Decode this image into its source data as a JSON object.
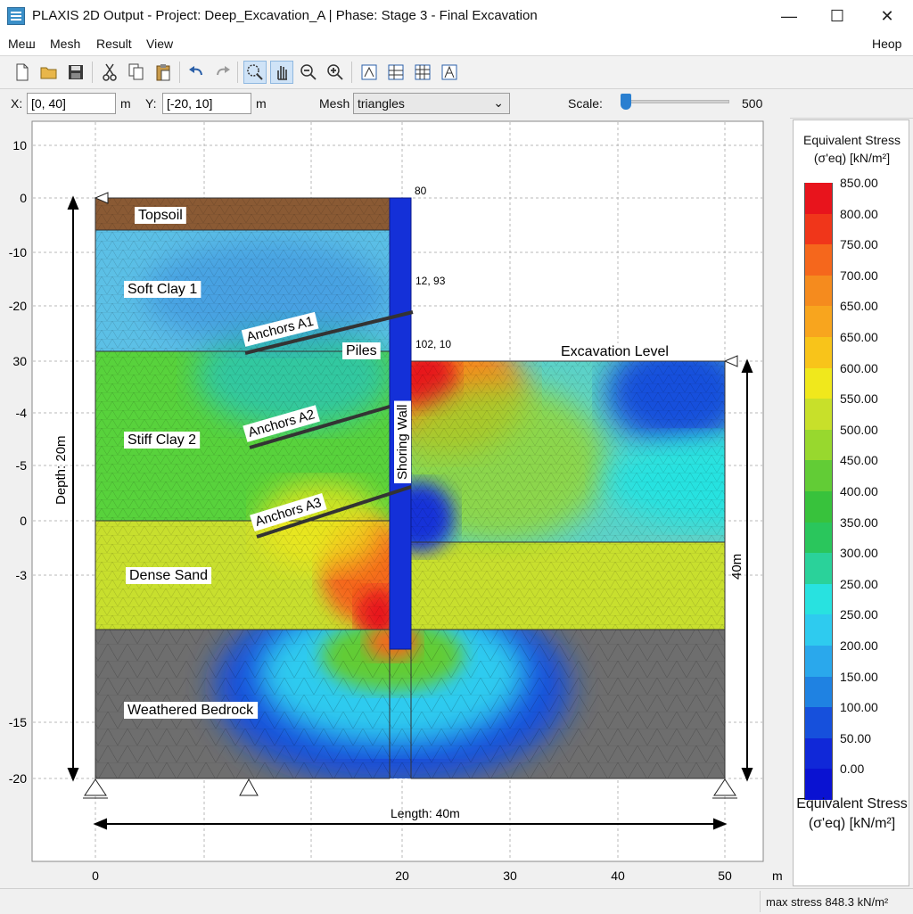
{
  "window": {
    "title": "PLAXIS 2D Output - Project: Deep_Excavation_A | Phase: Stage 3 - Final Excavation",
    "minimize": "—",
    "maximize": "☐",
    "close": "✕"
  },
  "menu": {
    "items": [
      "Meш",
      "Mesh",
      "Result",
      "View"
    ],
    "help": "Неор"
  },
  "toolbar": {
    "icons": [
      "new-file-icon",
      "open-folder-icon",
      "save-icon",
      "cut-icon",
      "copy-icon",
      "paste-icon",
      "undo-icon",
      "redo-icon",
      "zoom-window-icon",
      "pan-hand-icon",
      "zoom-out-icon",
      "zoom-in-icon",
      "view-front-icon",
      "view-mesh-icon",
      "view-grid-icon",
      "view-structure-icon"
    ]
  },
  "coords": {
    "x_label": "X:",
    "x_value": "[0, 40]",
    "x_unit": "m",
    "y_label": "Y:",
    "y_value": "[-20, 10]",
    "y_unit": "m",
    "mesh_label": "Mesh",
    "mesh_value": "triangles",
    "scale_label": "Scale:",
    "scale_value": "500",
    "scale_fraction": 0.0
  },
  "plot": {
    "y_ticks": [
      "10",
      "0",
      "-10",
      "-20",
      "30",
      "-4",
      "-5",
      "0",
      "-3",
      "-15",
      "-20"
    ],
    "x_ticks": [
      "0",
      "20",
      "30",
      "40",
      "50"
    ],
    "x_unit": "m",
    "layers": [
      "Topsoil",
      "Soft Clay 1",
      "Stiff Clay 2",
      "Dense Sand",
      "Weathered Bedrock"
    ],
    "anchors": [
      "Anchors A1",
      "Anchors A2",
      "Anchors A3"
    ],
    "piles_label": "Piles",
    "wall_label": "Shoring Wall",
    "excavation_label": "Excavation Level",
    "depth_label": "Depth: 20m",
    "height_label": "40m",
    "length_label": "Length: 40m",
    "annot_top": "80",
    "annot_mid": "12, 93",
    "annot_low": "102, 10"
  },
  "legend": {
    "title_line1": "Equivalent Stress",
    "title_line2": "(σ'eq) [kN/m²]",
    "entries": [
      {
        "label": "850.00",
        "color": "#e8141c"
      },
      {
        "label": "800.00",
        "color": "#f0361a"
      },
      {
        "label": "750.00",
        "color": "#f5671c"
      },
      {
        "label": "700.00",
        "color": "#f58b1e"
      },
      {
        "label": "650.00",
        "color": "#f8a51e"
      },
      {
        "label": "650.00",
        "color": "#f8c41a"
      },
      {
        "label": "600.00",
        "color": "#f0e81c"
      },
      {
        "label": "550.00",
        "color": "#c8e02a"
      },
      {
        "label": "500.00",
        "color": "#98d82e"
      },
      {
        "label": "450.00",
        "color": "#62cc36"
      },
      {
        "label": "400.00",
        "color": "#38c23c"
      },
      {
        "label": "350.00",
        "color": "#2ac65c"
      },
      {
        "label": "300.00",
        "color": "#2ad29a"
      },
      {
        "label": "250.00",
        "color": "#28e2e0"
      },
      {
        "label": "250.00",
        "color": "#2ecbef"
      },
      {
        "label": "200.00",
        "color": "#2aa8ec"
      },
      {
        "label": "150.00",
        "color": "#1f82e2"
      },
      {
        "label": "100.00",
        "color": "#1650dc"
      },
      {
        "label": "50.00",
        "color": "#1028d8"
      },
      {
        "label": "0.00",
        "color": "#0a12d2"
      }
    ],
    "bottom_line1": "Equivalent Stress",
    "bottom_line2": "(σ'eq) [kN/m²]"
  },
  "status": {
    "text": "max stress  848.3 kN/m²"
  },
  "colors": {
    "topsoil": "#8a5a34",
    "soft_clay": "#5cc0e6",
    "stiff_clay": "#58d23c",
    "dense_sand": "#c8df2e",
    "bedrock": "#6e6e6e",
    "wall": "#1430d8"
  }
}
